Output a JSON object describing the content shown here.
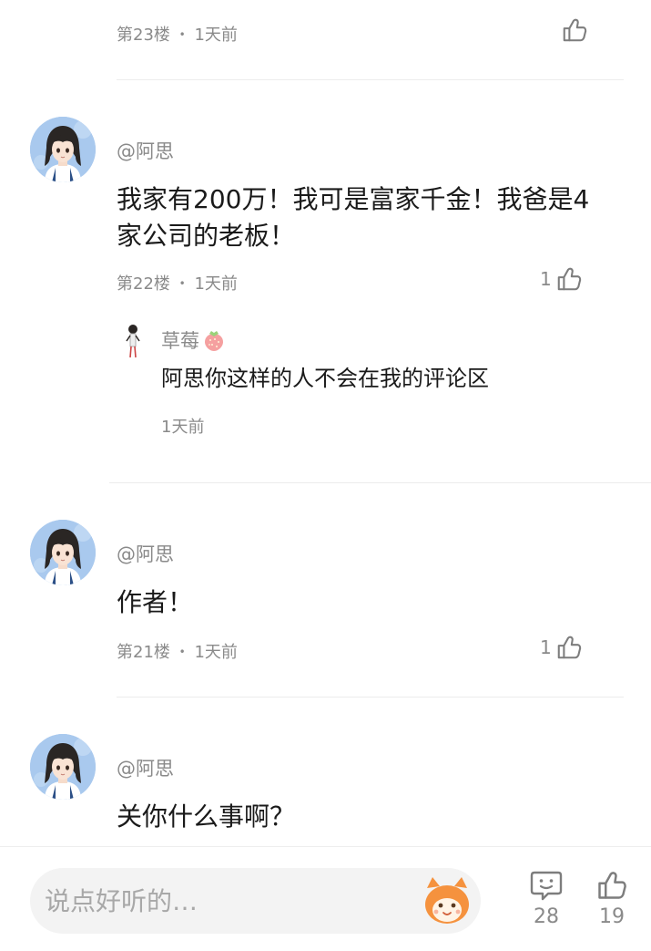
{
  "comments": [
    {
      "floor": "第23楼",
      "time": "1天前",
      "likes": ""
    },
    {
      "user": "@阿思",
      "content": "我家有200万！我可是富家千金！我爸是4家公司的老板！",
      "floor": "第22楼",
      "time": "1天前",
      "likes": "1",
      "reply": {
        "user": "草莓",
        "content": "阿思你这样的人不会在我的评论区",
        "time": "1天前"
      }
    },
    {
      "user": "@阿思",
      "content": "作者！",
      "floor": "第21楼",
      "time": "1天前",
      "likes": "1"
    },
    {
      "user": "@阿思",
      "content": "关你什么事啊？"
    }
  ],
  "meta_separator": "•",
  "bottom_bar": {
    "input_placeholder": "说点好听的…",
    "comment_count": "28",
    "like_count": "19"
  },
  "icons": {
    "like": "thumbs-up-icon",
    "comment": "comment-bubble-icon",
    "reply_badge": "strawberry-icon",
    "mascot": "orange-mascot-icon"
  },
  "colors": {
    "text": "#1a1a1a",
    "muted": "#8a8a8a",
    "divider": "#ececec",
    "avatar_bg": "#a9c9ee",
    "mascot": "#f5923e"
  }
}
